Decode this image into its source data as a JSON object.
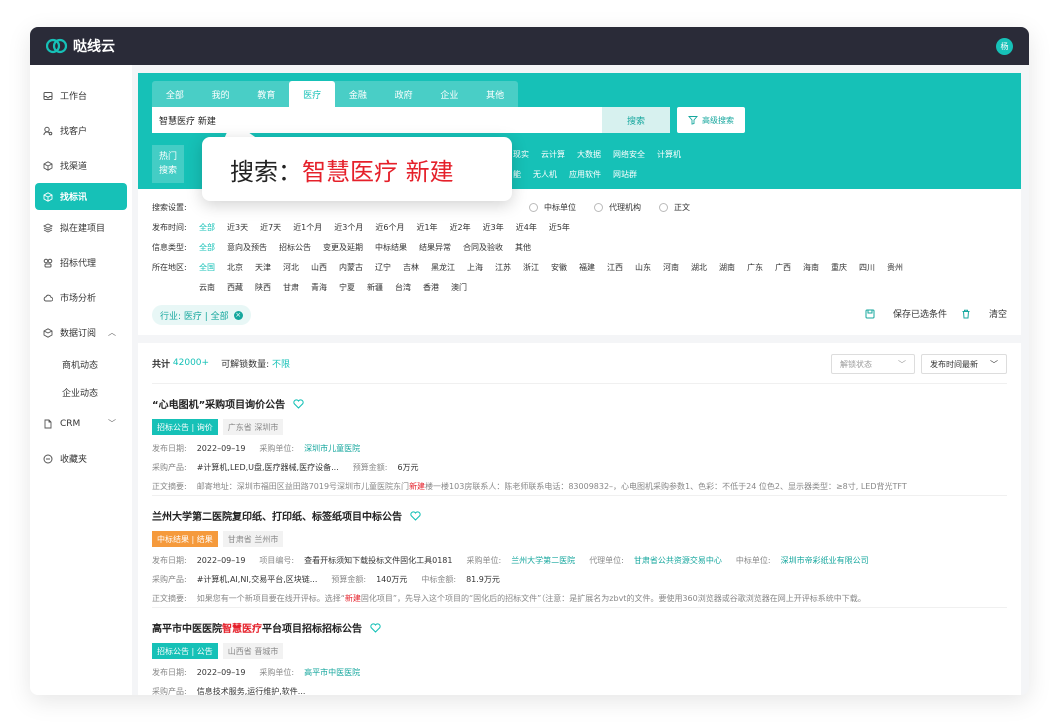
{
  "app": {
    "name": "哒线云",
    "avatar": "杨"
  },
  "sidebar": {
    "items": [
      {
        "label": "工作台",
        "icon": "inbox-icon"
      },
      {
        "label": "找客户",
        "icon": "user-search-icon"
      },
      {
        "label": "找渠道",
        "icon": "cube-icon"
      },
      {
        "label": "找标讯",
        "icon": "cube-icon",
        "active": true
      },
      {
        "label": "拟在建项目",
        "icon": "layers-icon"
      },
      {
        "label": "招标代理",
        "icon": "agent-icon"
      },
      {
        "label": "市场分析",
        "icon": "cloud-icon"
      },
      {
        "label": "数据订阅",
        "icon": "box-icon"
      },
      {
        "label": "CRM",
        "icon": "crm-icon"
      },
      {
        "label": "收藏夹",
        "icon": "favorite-icon"
      }
    ],
    "subitems": [
      "商机动态",
      "企业动态"
    ]
  },
  "search": {
    "tabs": [
      "全部",
      "我的",
      "教育",
      "医疗",
      "金融",
      "政府",
      "企业",
      "其他"
    ],
    "active_tab": "医疗",
    "query": "智慧医疗 新建",
    "search_button": "搜索",
    "advanced_button": "高级搜索",
    "hot_label_1": "热门",
    "hot_label_2": "搜索",
    "hot_row1": [
      "现实",
      "云计算",
      "大数据",
      "网络安全",
      "计算机"
    ],
    "hot_row2": [
      "能",
      "无人机",
      "应用软件",
      "网站群"
    ]
  },
  "popup": {
    "prefix": "搜索：",
    "highlight": "智慧医疗 新建"
  },
  "filters": {
    "settings_label": "搜索设置:",
    "settings_options": [
      "中标单位",
      "代理机构",
      "正文"
    ],
    "time_label": "发布时间:",
    "time_options": [
      "全部",
      "近3天",
      "近7天",
      "近1个月",
      "近3个月",
      "近6个月",
      "近1年",
      "近2年",
      "近3年",
      "近4年",
      "近5年"
    ],
    "type_label": "信息类型:",
    "type_options": [
      "全部",
      "意向及预告",
      "招标公告",
      "变更及延期",
      "中标结果",
      "结果异常",
      "合同及验收",
      "其他"
    ],
    "region_label": "所在地区:",
    "region_row1": [
      "全国",
      "北京",
      "天津",
      "河北",
      "山西",
      "内蒙古",
      "辽宁",
      "吉林",
      "黑龙江",
      "上海",
      "江苏",
      "浙江",
      "安徽",
      "福建",
      "江西",
      "山东",
      "河南",
      "湖北",
      "湖南",
      "广东",
      "广西",
      "海南",
      "重庆",
      "四川",
      "贵州"
    ],
    "region_row2": [
      "云南",
      "西藏",
      "陕西",
      "甘肃",
      "青海",
      "宁夏",
      "新疆",
      "台湾",
      "香港",
      "澳门"
    ],
    "chip": "行业:  医疗 | 全部",
    "save_label": "保存已选条件",
    "clear_label": "清空"
  },
  "results": {
    "total_label": "共计",
    "total_value": "42000+",
    "unlock_label": "可解锁数量:",
    "unlock_value": "不限",
    "unlock_status": "解锁状态",
    "sort": "发布时间最新",
    "items": [
      {
        "title": "“心电图机”采购项目询价公告",
        "tag": "招标公告 | 询价",
        "region": "广东省 深圳市",
        "date_label": "发布日期:",
        "date": "2022–09–19",
        "buyer_label": "采购单位:",
        "buyer": "深圳市儿童医院",
        "product_label": "采购产品:",
        "product": "#计算机,LED,U盘,医疗器械,医疗设备...",
        "budget_label": "预算金额:",
        "budget": "6万元",
        "summary_label": "正文摘要:",
        "summary_a": "邮寄地址：深圳市福田区益田路7019号深圳市儿童医院东门",
        "summary_hl": "新建",
        "summary_b": "楼一楼103房联系人：陈老师联系电话：83009832–，心电图机采购参数1、色彩：不低于24 位色2、显示器类型：≥8寸, LED背光TFT"
      },
      {
        "title": "兰州大学第二医院复印纸、打印纸、标签纸项目中标公告",
        "tag": "中标结果 | 结果",
        "region": "甘肃省 兰州市",
        "date_label": "发布日期:",
        "date": "2022–09–19",
        "code_label": "项目编号:",
        "code": "查看开标须知下载投标文件固化工具0181",
        "buyer_label": "采购单位:",
        "buyer": "兰州大学第二医院",
        "agent_label": "代理单位:",
        "agent": "甘肃省公共资源交易中心",
        "winner_label": "中标单位:",
        "winner": "深圳市帝彩纸业有限公司",
        "product_label": "采购产品:",
        "product": "#计算机,AI,NI,交易平台,区块链...",
        "budget_label": "预算金额:",
        "budget": "140万元",
        "win_amount_label": "中标金额:",
        "win_amount": "81.9万元",
        "summary_label": "正文摘要:",
        "summary_a": "如果您有一个新项目要在线开评标。选择“",
        "summary_hl": "新建",
        "summary_b": "固化项目”，先导入这个项目的“固化后的招标文件”（注意：是扩展名为zbvt的文件。要使用360浏览器或谷歌浏览器在网上开评标系统中下载。"
      },
      {
        "title_a": "高平市中医医院",
        "title_hl": "智慧医疗",
        "title_b": "平台项目招标招标公告",
        "tag": "招标公告 | 公告",
        "region": "山西省 晋城市",
        "date_label": "发布日期:",
        "date": "2022–09–19",
        "buyer_label": "采购单位:",
        "buyer": "高平市中医医院",
        "product_label": "采购产品:",
        "product": "信息技术服务,运行维护,软件..."
      }
    ]
  },
  "colors": {
    "accent": "#16c1b7",
    "highlight": "#e5202a",
    "tag_orange": "#f59a3c",
    "topbar": "#2a2b38"
  }
}
